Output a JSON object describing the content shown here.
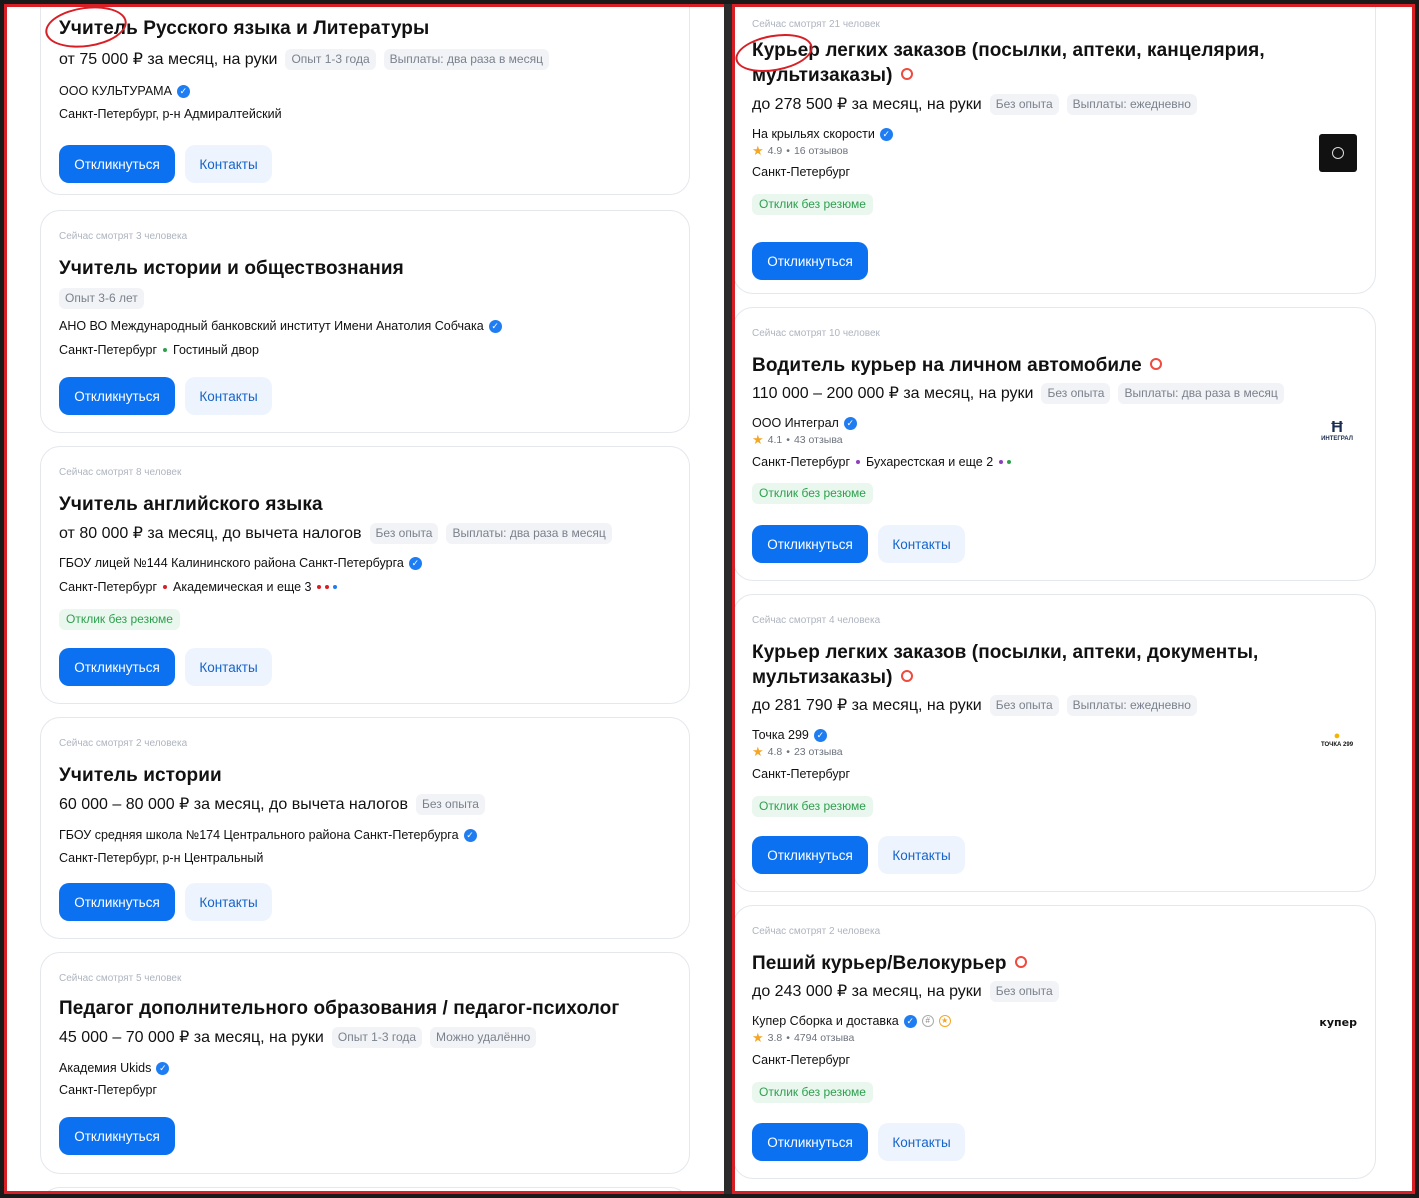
{
  "left_cards": [
    {
      "views": "",
      "title": "Учитель Русского языка и Литературы",
      "salary": "от 75 000 ₽ за месяц, на руки",
      "tags": [
        "Опыт 1-3 года",
        "Выплаты: два раза в месяц"
      ],
      "employer": "ООО КУЛЬТУРАМА",
      "location": "Санкт-Петербург, р-н Адмиралтейский",
      "metro": [],
      "metro_suffix": "",
      "no_resume": "",
      "apply": "Откликнуться",
      "contacts": "Контакты"
    },
    {
      "views": "Сейчас смотрят 3 человека",
      "title": "Учитель истории и обществознания",
      "salary": "",
      "tags": [
        "Опыт 3-6 лет"
      ],
      "employer": "АНО ВО Международный банковский институт Имени Анатолия Собчака",
      "location": "Санкт-Петербург",
      "metro": [
        "Гостиный двор"
      ],
      "metro_suffix": "",
      "no_resume": "",
      "apply": "Откликнуться",
      "contacts": "Контакты"
    },
    {
      "views": "Сейчас смотрят 8 человек",
      "title": "Учитель английского языка",
      "salary": "от 80 000 ₽ за месяц, до вычета налогов",
      "tags": [
        "Без опыта",
        "Выплаты: два раза в месяц"
      ],
      "employer": "ГБОУ лицей №144 Калининского района Санкт-Петербурга",
      "location": "Санкт-Петербург",
      "metro": [
        "Академическая и еще 3"
      ],
      "metro_suffix": "",
      "no_resume": "Отклик без резюме",
      "apply": "Откликнуться",
      "contacts": "Контакты"
    },
    {
      "views": "Сейчас смотрят 2 человека",
      "title": "Учитель истории",
      "salary": "60 000 – 80 000 ₽ за месяц, до вычета налогов",
      "tags": [
        "Без опыта"
      ],
      "employer": "ГБОУ средняя школа №174 Центрального района Санкт-Петербурга",
      "location": "Санкт-Петербург, р-н Центральный",
      "metro": [],
      "metro_suffix": "",
      "no_resume": "",
      "apply": "Откликнуться",
      "contacts": "Контакты"
    },
    {
      "views": "Сейчас смотрят 5 человек",
      "title": "Педагог дополнительного образования / педагог-психолог",
      "salary": "45 000 – 70 000 ₽ за месяц, на руки",
      "tags": [
        "Опыт 1-3 года",
        "Можно удалённо"
      ],
      "employer": "Академия Ukids",
      "location": "Санкт-Петербург",
      "metro": [],
      "metro_suffix": "",
      "no_resume": "",
      "apply": "Откликнуться",
      "contacts": ""
    }
  ],
  "right_cards": [
    {
      "views": "Сейчас смотрят 21 человек",
      "title_line1": "Курьер легких заказов (посылки, аптеки, канцелярия,",
      "title_line2": "мультизаказы)",
      "salary": "до 278 500 ₽ за месяц, на руки",
      "tags": [
        "Без опыта",
        "Выплаты: ежедневно"
      ],
      "employer": "На крыльях скорости",
      "rating": "4.9",
      "reviews": "16 отзывов",
      "location": "Санкт-Петербург",
      "metro": "",
      "no_resume": "Отклик без резюме",
      "apply": "Откликнуться",
      "contacts": "",
      "logo": "wings-logo"
    },
    {
      "views": "Сейчас смотрят 10 человек",
      "title_line1": "Водитель курьер на личном автомобиле",
      "title_line2": "",
      "salary": "110 000 – 200 000 ₽ за месяц, на руки",
      "tags": [
        "Без опыта",
        "Выплаты: два раза в месяц"
      ],
      "employer": "ООО Интеграл",
      "rating": "4.1",
      "reviews": "43 отзыва",
      "location": "Санкт-Петербург",
      "metro": "Бухарестская и еще 2",
      "no_resume": "Отклик без резюме",
      "apply": "Откликнуться",
      "contacts": "Контакты",
      "logo": "integral-logo",
      "logo_text": "ИНТЕГРАЛ"
    },
    {
      "views": "Сейчас смотрят 4 человека",
      "title_line1": "Курьер легких заказов (посылки, аптеки, документы,",
      "title_line2": "мультизаказы)",
      "salary": "до 281 790 ₽ за месяц, на руки",
      "tags": [
        "Без опыта",
        "Выплаты: ежедневно"
      ],
      "employer": "Точка 299",
      "rating": "4.8",
      "reviews": "23 отзыва",
      "location": "Санкт-Петербург",
      "metro": "",
      "no_resume": "Отклик без резюме",
      "apply": "Откликнуться",
      "contacts": "Контакты",
      "logo": "tochka-logo",
      "logo_text": "ТОЧКА 299"
    },
    {
      "views": "Сейчас смотрят 2 человека",
      "title_line1": "Пеший курьер/Велокурьер",
      "title_line2": "",
      "salary": "до 243 000 ₽ за месяц, на руки",
      "tags": [
        "Без опыта"
      ],
      "employer": "Купер Сборка и доставка",
      "rating": "3.8",
      "reviews": "4794 отзыва",
      "location": "Санкт-Петербург",
      "metro": "",
      "no_resume": "Отклик без резюме",
      "apply": "Откликнуться",
      "contacts": "Контакты",
      "logo": "kuper-logo",
      "logo_text": "купер"
    }
  ],
  "colors": {
    "accent": "#0b71f0",
    "annotation_red": "#d81f26",
    "no_resume_green": "#2da04e",
    "hot_badge": "#f0493e"
  }
}
